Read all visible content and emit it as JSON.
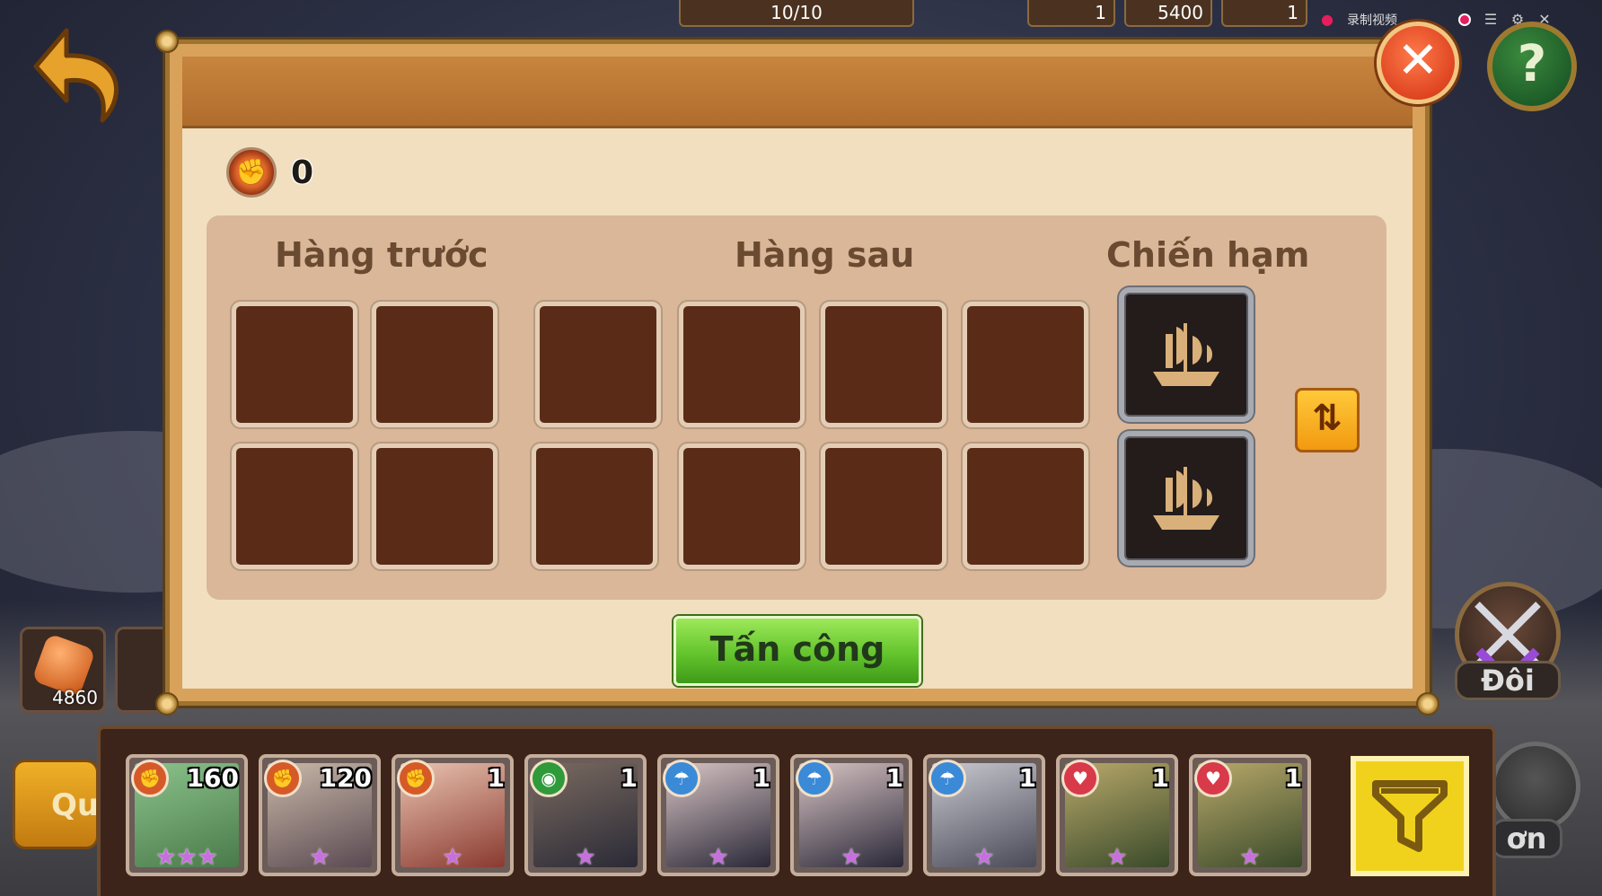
{
  "recording": {
    "label": "录制视频"
  },
  "top_bar": {
    "counter": "10/10",
    "resources": [
      "1",
      "5400",
      "1"
    ]
  },
  "side": {
    "gem_count": "4860",
    "left_button": "Quả",
    "duel_label": "Đôi",
    "duel2_label": "ơn"
  },
  "help": {
    "symbol": "?"
  },
  "modal": {
    "close_symbol": "✕",
    "power_value": "0",
    "columns": {
      "front": "Hàng trước",
      "back": "Hàng sau",
      "ship": "Chiến hạm"
    },
    "swap_symbol": "⇅",
    "attack_label": "Tấn công"
  },
  "roster": [
    {
      "type": "strength",
      "level": "160",
      "stars": "★★★",
      "palette": [
        "#8bc28b",
        "#4a7a4a"
      ]
    },
    {
      "type": "strength",
      "level": "120",
      "stars": "★",
      "palette": [
        "#c9b8a8",
        "#5a4a52"
      ]
    },
    {
      "type": "strength",
      "level": "1",
      "stars": "★",
      "palette": [
        "#e9c3b0",
        "#8a3a30"
      ]
    },
    {
      "type": "eye",
      "level": "1",
      "stars": "★",
      "palette": [
        "#7a6a60",
        "#2a2a36"
      ]
    },
    {
      "type": "water",
      "level": "1",
      "stars": "★",
      "palette": [
        "#d8c4c4",
        "#2a2838"
      ]
    },
    {
      "type": "water",
      "level": "1",
      "stars": "★",
      "palette": [
        "#d8c4c4",
        "#2a2838"
      ]
    },
    {
      "type": "water",
      "level": "1",
      "stars": "★",
      "palette": [
        "#c8c8d0",
        "#4a4a58"
      ]
    },
    {
      "type": "heart",
      "level": "1",
      "stars": "★",
      "palette": [
        "#b8a86a",
        "#3a4a2a"
      ]
    },
    {
      "type": "heart",
      "level": "1",
      "stars": "★",
      "palette": [
        "#b8a86a",
        "#3a4a2a"
      ]
    }
  ],
  "colors": {
    "strength": "#d65a28",
    "eye": "#2f9a3a",
    "water": "#3a8ad8",
    "heart": "#d83a4a"
  }
}
